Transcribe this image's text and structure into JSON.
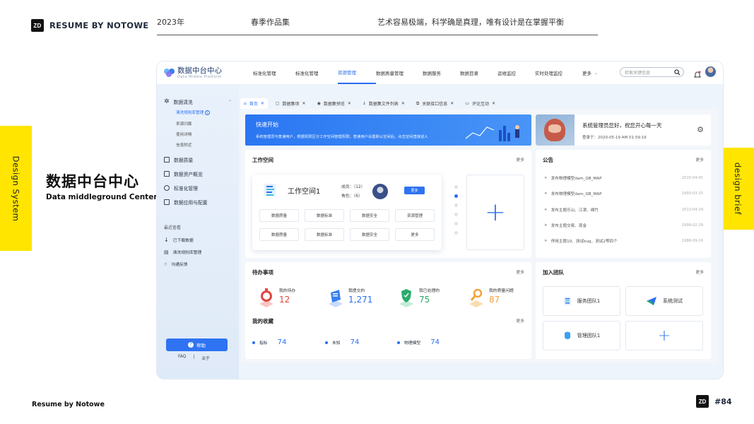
{
  "header": {
    "brand": "RESUME BY NOTOWE",
    "logo_text": "ZD",
    "year": "2023年",
    "collection": "春季作品集",
    "motto": "艺术容易极端，科学确是真理，唯有设计是在掌握平衡"
  },
  "left_tab": "Design System",
  "right_tab": "design brief",
  "title": {
    "cn": "数据中台中心",
    "en": "Data middleground Center"
  },
  "footer": {
    "brand": "Resume by Notowe",
    "page": "#84"
  },
  "colors": {
    "accent": "#2f73f2",
    "yellow": "#ffe500",
    "red": "#e0453d",
    "green": "#2bab6b",
    "orange": "#f2a23a",
    "blue": "#2a6ef3"
  },
  "app": {
    "logo_title": "数据中台中心",
    "logo_sub": "Data Middle Platform",
    "nav": [
      "标准化管理",
      "标准化管理",
      "资源管理",
      "数据质量管理",
      "数据服务",
      "数据目录",
      "运维监控",
      "实时处理监控",
      "更多"
    ],
    "nav_active": 2,
    "search_placeholder": "检索关键信息",
    "sidebar": {
      "group1": "数据清洗",
      "sub": [
        "清洗规则库管理",
        "来源归属",
        "使用详情",
        "信息附近"
      ],
      "items": [
        "数据质量",
        "数据资产概览",
        "标准化管理",
        "数据应用与配置"
      ],
      "recent_title": "最近查看",
      "recent": [
        "已下载数据",
        "清洗规则库管理",
        "沟通反馈"
      ],
      "help": "帮助",
      "faq": "FAQ",
      "sep": "|",
      "about": "关于"
    },
    "tabs": [
      "首页",
      "数据集项",
      "数据集预览",
      "数据集文件列表",
      "关联接口信息",
      "评论互动"
    ],
    "banner": {
      "title": "快速开始",
      "desc": "系统管理员与普通用户，根据权限区分工作空间管理权限；普通用户设置默认空间后，点击空间直接进入"
    },
    "user": {
      "greeting": "系统管理员您好，祝您开心每一天",
      "login": "登录于：2020-05-19  AM 01:59:19"
    },
    "workspace": {
      "title": "工作空间",
      "more": "更多",
      "name": "工作空间1",
      "members_label": "成员：",
      "members": "（12）",
      "roles_label": "角色：",
      "roles": "（6）",
      "more_btn": "更多",
      "buttons": [
        "数据质量",
        "数据标准",
        "数据安全",
        "资源管理",
        "数据质量",
        "数据标准",
        "数据安全",
        "更多"
      ]
    },
    "notice": {
      "title": "公告",
      "more": "更多",
      "items": [
        {
          "text": "发布物理模型dam_GB_MAP",
          "date": "2015-04-05"
        },
        {
          "text": "发布物理模型dam_GB_MAP",
          "date": "1993-03-15"
        },
        {
          "text": "发布主题乐山、江津、绵竹",
          "date": "2013-04-29"
        },
        {
          "text": "发布主题交易、现金",
          "date": "1999-02-28"
        },
        {
          "text": "停用主题10、测试bug、测试2等四个",
          "date": "1986-09-16"
        }
      ]
    },
    "todo": {
      "title": "待办事项",
      "more": "更多",
      "items": [
        {
          "label": "我的待办",
          "value": "12"
        },
        {
          "label": "我提交的",
          "value": "1,271"
        },
        {
          "label": "我已处理的",
          "value": "75"
        },
        {
          "label": "我的质量问题",
          "value": "87"
        }
      ]
    },
    "fav": {
      "title": "我的收藏",
      "more": "更多",
      "items": [
        {
          "label": "指标",
          "value": "74"
        },
        {
          "label": "未知",
          "value": "74"
        },
        {
          "label": "物理模型",
          "value": "74"
        }
      ]
    },
    "team": {
      "title": "加入团队",
      "more": "更多",
      "items": [
        "服务团队1",
        "系统测试",
        "管理团队1"
      ]
    }
  }
}
